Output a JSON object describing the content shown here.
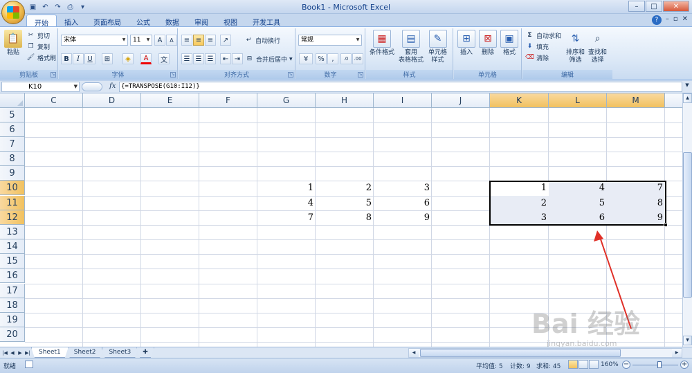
{
  "window": {
    "title": "Book1 - Microsoft Excel"
  },
  "tabs": [
    "开始",
    "插入",
    "页面布局",
    "公式",
    "数据",
    "审阅",
    "视图",
    "开发工具"
  ],
  "ribbon": {
    "clipboard": {
      "paste": "粘贴",
      "cut": "剪切",
      "copy": "复制",
      "format_painter": "格式刷",
      "label": "剪贴板"
    },
    "font": {
      "name": "宋体",
      "size": "11",
      "bold": "B",
      "italic": "I",
      "underline": "U",
      "label": "字体"
    },
    "alignment": {
      "wrap": "自动换行",
      "merge": "合并后居中",
      "label": "对齐方式"
    },
    "number": {
      "format": "常规",
      "percent": "%",
      "comma": ",",
      "label": "数字"
    },
    "styles": {
      "conditional": "条件格式",
      "table1": "套用",
      "table2": "表格格式",
      "cell1": "单元格",
      "cell2": "样式",
      "label": "样式"
    },
    "cells": {
      "insert": "插入",
      "delete": "删除",
      "format": "格式",
      "label": "单元格"
    },
    "editing": {
      "autosum": "自动求和",
      "fill": "填充",
      "clear": "清除",
      "sort1": "排序和",
      "sort2": "筛选",
      "find1": "查找和",
      "find2": "选择",
      "label": "编辑"
    }
  },
  "formula_bar": {
    "name_box": "K10",
    "fx": "fx",
    "formula": "{=TRANSPOSE(G10:I12)}"
  },
  "columns": [
    "C",
    "D",
    "E",
    "F",
    "G",
    "H",
    "I",
    "J",
    "K",
    "L",
    "M"
  ],
  "rows": [
    "5",
    "6",
    "7",
    "8",
    "9",
    "10",
    "11",
    "12",
    "13",
    "14",
    "15",
    "16",
    "17",
    "18",
    "19",
    "20"
  ],
  "cells": {
    "G10": "1",
    "H10": "2",
    "I10": "3",
    "G11": "4",
    "H11": "5",
    "I11": "6",
    "G12": "7",
    "H12": "8",
    "I12": "9",
    "K10": "1",
    "L10": "4",
    "M10": "7",
    "K11": "2",
    "L11": "5",
    "M11": "8",
    "K12": "3",
    "L12": "6",
    "M12": "9"
  },
  "sheets": [
    "Sheet1",
    "Sheet2",
    "Sheet3"
  ],
  "status": {
    "ready": "就绪",
    "average": "平均值: 5",
    "count": "计数: 9",
    "sum": "求和: 45",
    "zoom": "160%"
  },
  "watermark": {
    "main": "Bai 经验",
    "url": "jingyan.baidu.com"
  },
  "colors": {
    "accent": "#f1c15f",
    "selection_fill": "#e8ecf5",
    "arrow": "#e03028"
  }
}
